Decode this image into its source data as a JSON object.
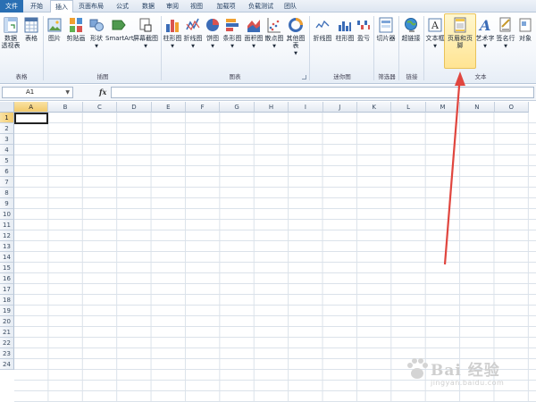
{
  "tabs": [
    "文件",
    "开始",
    "插入",
    "页面布局",
    "公式",
    "数据",
    "审阅",
    "视图",
    "加载项",
    "负载测试",
    "团队"
  ],
  "active_tab": "插入",
  "ribbon": {
    "groups": {
      "tables": "表格",
      "illustrations": "插图",
      "charts": "图表",
      "sparklines": "迷你图",
      "filter": "筛选器",
      "links": "链接",
      "text": "文本"
    },
    "buttons": {
      "pivot_line1": "数据",
      "pivot_line2": "透视表",
      "table": "表格",
      "picture": "图片",
      "clipart": "剪贴画",
      "shapes": "形状",
      "smartart": "SmartArt",
      "screenshot": "屏幕截图",
      "column_chart": "柱形图",
      "line_chart": "折线图",
      "pie_chart": "饼图",
      "bar_chart": "条形图",
      "area_chart": "面积图",
      "scatter_chart": "散点图",
      "other_chart": "其他图表",
      "spark_line": "折线图",
      "spark_column": "柱形图",
      "spark_winloss": "盈亏",
      "slicer": "切片器",
      "hyperlink": "超链接",
      "textbox": "文本框",
      "header_footer": "页眉和页脚",
      "wordart": "艺术字",
      "signature_line": "签名行",
      "object": "对象"
    }
  },
  "formula_bar": {
    "name_box": "A1",
    "fx": "fx",
    "formula": ""
  },
  "columns": [
    "A",
    "B",
    "C",
    "D",
    "E",
    "F",
    "G",
    "H",
    "I",
    "J",
    "K",
    "L",
    "M",
    "N",
    "O"
  ],
  "rows": [
    "1",
    "2",
    "3",
    "4",
    "5",
    "6",
    "7",
    "8",
    "9",
    "10",
    "11",
    "12",
    "13",
    "14",
    "15",
    "16",
    "17",
    "18",
    "19",
    "20",
    "21",
    "22",
    "23",
    "24"
  ],
  "selected_cell": "A1",
  "watermark": {
    "brand": "Bai 经验",
    "url": "jingyan.baidu.com"
  },
  "colors": {
    "file_tab": "#2a6fb3",
    "highlight": "#ffe493",
    "arrow": "#e0463f"
  }
}
